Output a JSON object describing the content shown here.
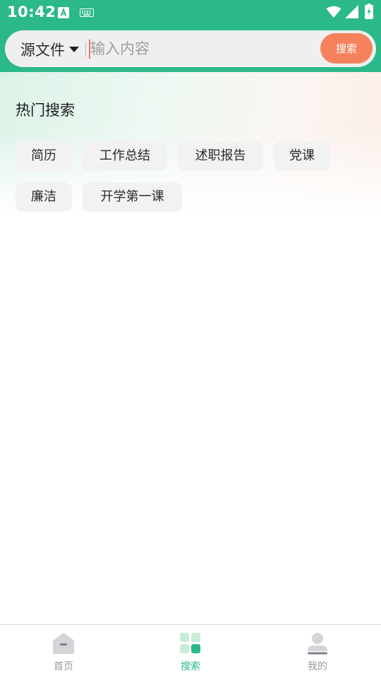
{
  "status_bar": {
    "time": "10:42",
    "icons": [
      "a-notification-icon",
      "keyboard-icon",
      "wifi-icon",
      "signal-icon",
      "battery-icon"
    ]
  },
  "search": {
    "scope_label": "源文件",
    "placeholder": "输入内容",
    "button_label": "搜索"
  },
  "hot_search": {
    "title": "热门搜索",
    "tags": [
      "简历",
      "工作总结",
      "述职报告",
      "党课",
      "廉洁",
      "开学第一课"
    ]
  },
  "bottom_nav": {
    "items": [
      {
        "label": "首页",
        "icon": "home-icon",
        "active": false
      },
      {
        "label": "搜索",
        "icon": "grid-search-icon",
        "active": true
      },
      {
        "label": "我的",
        "icon": "user-icon",
        "active": false
      }
    ]
  },
  "colors": {
    "brand_green": "#2bb88a",
    "search_button": "#f5825c",
    "tag_background": "#f2f2f2"
  }
}
